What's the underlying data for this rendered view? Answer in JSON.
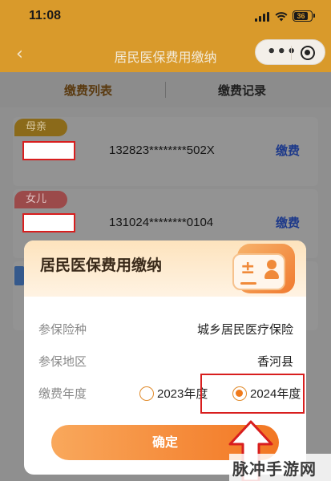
{
  "status_bar": {
    "time": "11:08",
    "battery": "36"
  },
  "navbar": {
    "back": "‹",
    "title": "居民医保费用缴纳",
    "menu_dots": "•••"
  },
  "tabs": [
    {
      "label": "缴费列表",
      "active": true
    },
    {
      "label": "缴费记录",
      "active": false
    }
  ],
  "list": [
    {
      "tag": "母亲",
      "id_number": "132823********502X",
      "action": "缴费"
    },
    {
      "tag": "女儿",
      "id_number": "131024********0104",
      "action": "缴费"
    }
  ],
  "modal": {
    "title": "居民医保费用缴纳",
    "fields": [
      {
        "label": "参保险种",
        "value": "城乡居民医疗保险"
      },
      {
        "label": "参保地区",
        "value": "香河县"
      }
    ],
    "year_label": "缴费年度",
    "year_options": [
      {
        "label": "2023年度",
        "selected": false
      },
      {
        "label": "2024年度",
        "selected": true
      }
    ],
    "confirm": "确定"
  },
  "watermark": "脉冲手游网",
  "colors": {
    "header": "#d99a2b",
    "accent": "#f27622",
    "annotation": "#d81e1e",
    "link": "#1e3a8a"
  }
}
